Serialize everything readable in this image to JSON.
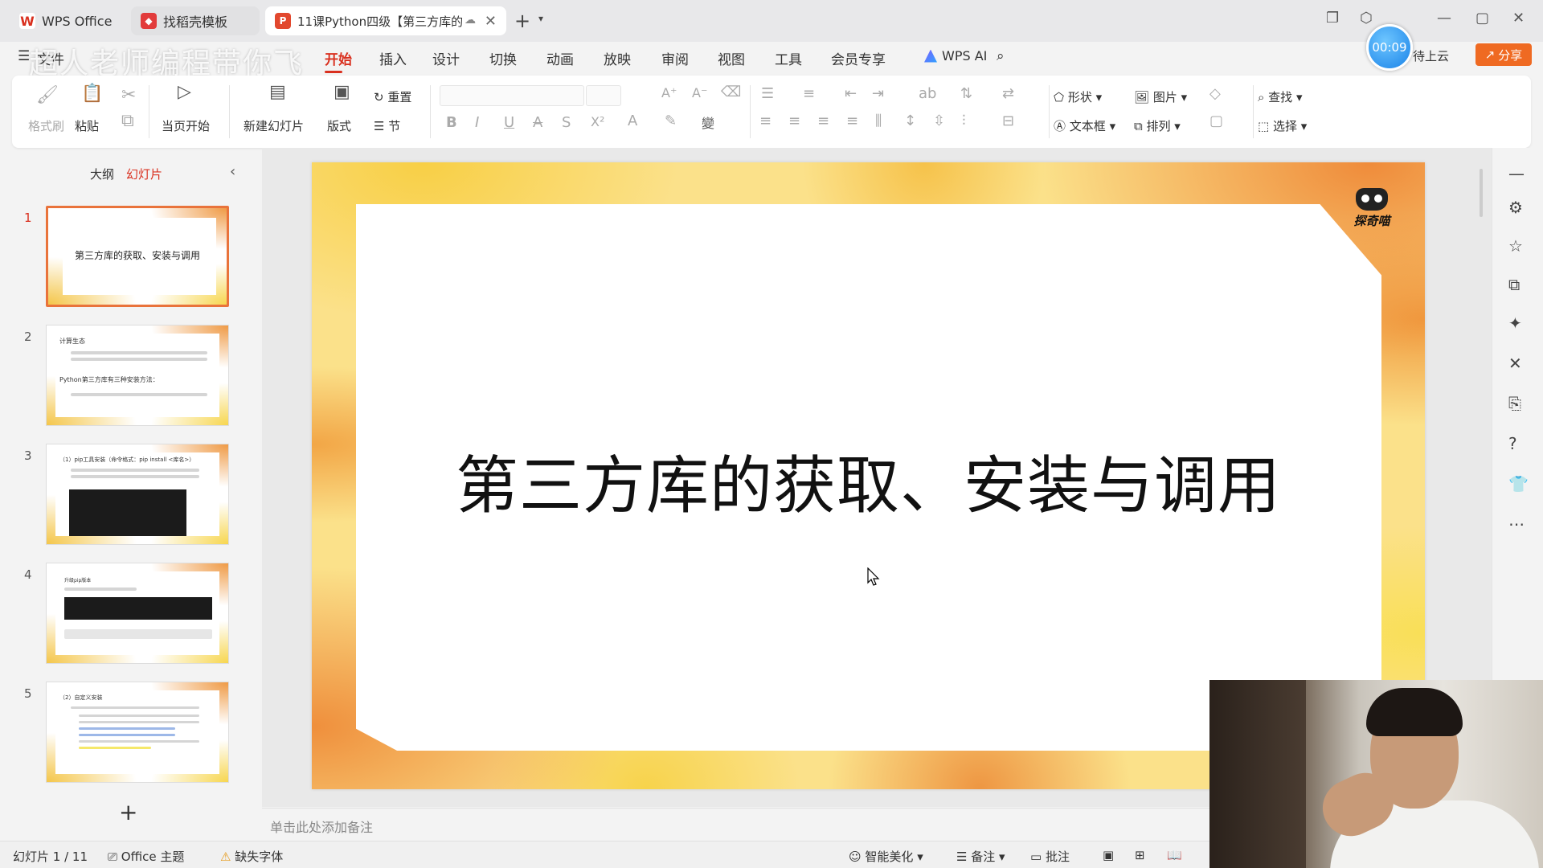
{
  "tabs": [
    {
      "label": "WPS Office",
      "icon": "wps-logo-icon"
    },
    {
      "label": "找稻壳模板",
      "icon": "daoke-icon"
    },
    {
      "label": "11课Python四级【第三方库的",
      "icon": "ppt-file-icon"
    }
  ],
  "overlay_title": "超人老师编程带你飞",
  "menu": [
    "文件",
    "开始",
    "插入",
    "设计",
    "切换",
    "动画",
    "放映",
    "审阅",
    "视图",
    "工具",
    "会员专享"
  ],
  "menu_active": "开始",
  "wps_ai": "WPS AI",
  "timer": "00:09",
  "sync_status": "待上云",
  "share": "分享",
  "ribbon": {
    "format_painter": "格式刷",
    "paste": "粘贴",
    "play_from_current": "当页开始",
    "new_slide": "新建幻灯片",
    "layout": "版式",
    "reset": "重置",
    "section": "节",
    "shape": "形状",
    "picture": "图片",
    "textbox": "文本框",
    "arrange": "排列",
    "find": "查找",
    "select": "选择"
  },
  "panel": {
    "tab_outline": "大纲",
    "tab_slides": "幻灯片"
  },
  "thumbnails": [
    {
      "num": "1",
      "title": "第三方库的获取、安装与调用"
    },
    {
      "num": "2",
      "title": "计算生态",
      "sub": "Python第三方库有三种安装方法："
    },
    {
      "num": "3",
      "title": "（1）pip工具安装（命令格式：pip install <库名>）"
    },
    {
      "num": "4",
      "title": "升级pip版本"
    },
    {
      "num": "5",
      "title": "（2）自定义安装"
    }
  ],
  "slide": {
    "title": "第三方库的获取、安装与调用",
    "logo_text": "探奇喵"
  },
  "notes_placeholder": "单击此处添加备注",
  "status": {
    "slide_counter": "幻灯片 1 / 11",
    "theme": "Office 主题",
    "missing_font": "缺失字体",
    "beautify": "智能美化",
    "notes": "备注",
    "comments": "批注"
  },
  "colors": {
    "accent": "#d9301f",
    "share": "#ef6a22",
    "slide_orange": "#ef8b3a",
    "slide_yellow": "#f8cf45"
  }
}
